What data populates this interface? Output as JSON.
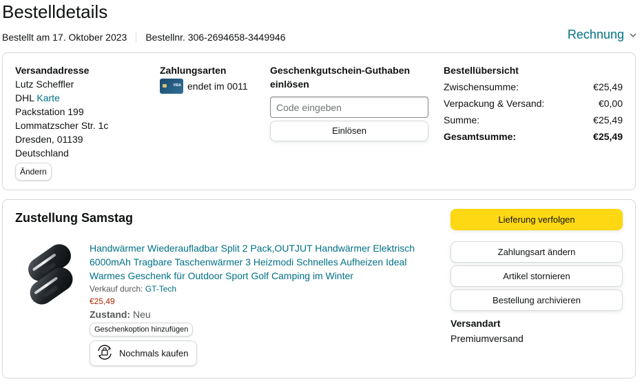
{
  "page": {
    "title": "Bestelldetails"
  },
  "meta": {
    "ordered": "Bestellt am 17. Oktober 2023",
    "order_number": "Bestellnr. 306-2694658-3449946",
    "invoice": "Rechnung",
    "invoice_icon": "chevron-down-icon"
  },
  "shipping_address": {
    "title": "Versandadresse",
    "name": "Lutz Scheffler",
    "carrier": "DHL",
    "map_link": "Karte",
    "line1": "Packstation 199",
    "line2": "Lommatzscher Str. 1c",
    "line3": "Dresden, 01139",
    "country": "Deutschland",
    "change": "Ändern"
  },
  "payment": {
    "title": "Zahlungsarten",
    "card_text": "endet im 0011",
    "card_icon": "credit-card-icon"
  },
  "gift_card": {
    "title": "Geschenkgutschein-Guthaben einlösen",
    "placeholder": "Code eingeben",
    "redeem": "Einlösen"
  },
  "summary": {
    "title": "Bestellübersicht",
    "rows": [
      {
        "label": "Zwischensumme:",
        "value": "€25,49"
      },
      {
        "label": "Verpackung & Versand:",
        "value": "€0,00"
      },
      {
        "label": "Summe:",
        "value": "€25,49"
      },
      {
        "label": "Gesamtsumme:",
        "value": "€25,49"
      }
    ]
  },
  "delivery": {
    "title": "Zustellung Samstag",
    "product": {
      "title": "Handwärmer Wiederaufladbar Split 2 Pack,OUTJUT Handwärmer Elektrisch 6000mAh Tragbare Taschenwärmer 3 Heizmodi Schnelles Aufheizen Ideal Warmes Geschenk für Outdoor Sport Golf Camping im Winter",
      "seller_label": "Verkauf durch:",
      "seller": "GT-Tech",
      "price": "€25,49",
      "condition_label": "Zustand:",
      "condition": "Neu",
      "gift_option": "Geschenkoption hinzufügen",
      "rebuy": "Nochmals kaufen",
      "rebuy_icon": "rebuy-icon",
      "image_icon": "hand-warmer-product-image"
    },
    "actions": {
      "track": "Lieferung verfolgen",
      "change_payment": "Zahlungsart ändern",
      "cancel": "Artikel stornieren",
      "archive": "Bestellung archivieren"
    },
    "ship_type_label": "Versandart",
    "ship_type": "Premiumversand"
  },
  "colors": {
    "link": "#007185",
    "price": "#b12704",
    "primary_button": "#ffd814",
    "border": "#d5d9d9"
  }
}
